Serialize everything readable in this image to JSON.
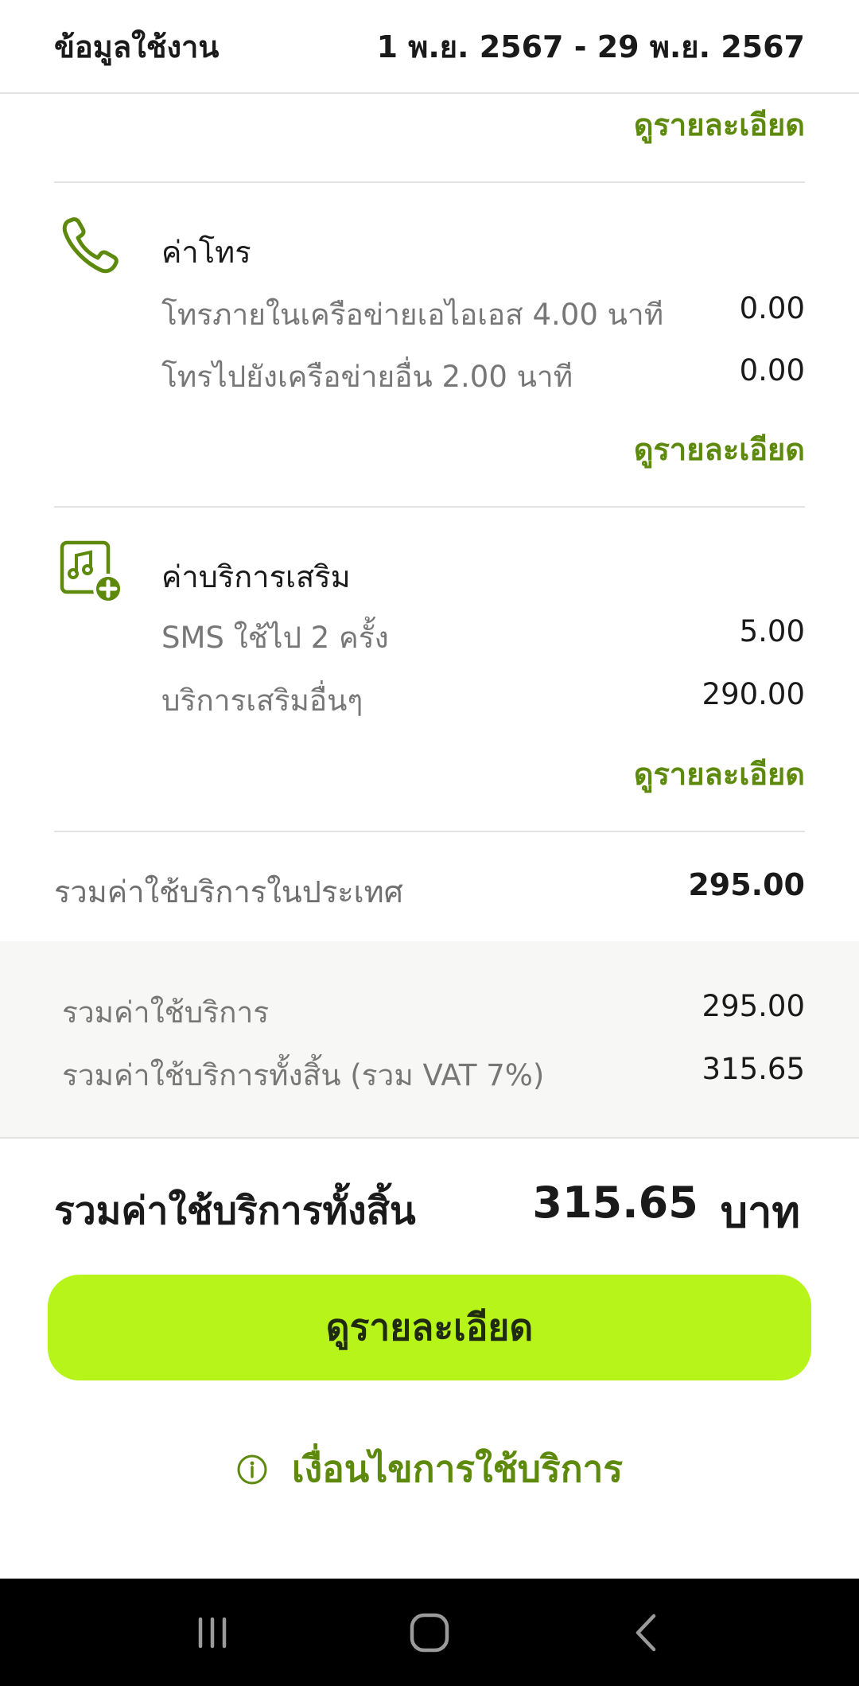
{
  "header": {
    "title": "ข้อมูลใช้งาน",
    "period": "1 พ.ย. 2567 - 29 พ.ย. 2567"
  },
  "top_link": "ดูรายละเอียด",
  "call_section": {
    "title": "ค่าโทร",
    "icon": "phone-icon",
    "rows": [
      {
        "label": "โทรภายในเครือข่ายเอไอเอส 4.00 นาที",
        "value": "0.00"
      },
      {
        "label": "โทรไปยังเครือข่ายอื่น 2.00 นาที",
        "value": "0.00"
      }
    ],
    "link": "ดูรายละเอียด"
  },
  "vas_section": {
    "title": "ค่าบริการเสริม",
    "icon": "music-add-icon",
    "rows": [
      {
        "label": "SMS ใช้ไป 2 ครั้ง",
        "value": "5.00"
      },
      {
        "label": "บริการเสริมอื่นๆ",
        "value": "290.00"
      }
    ],
    "link": "ดูรายละเอียด"
  },
  "domestic_total": {
    "label": "รวมค่าใช้บริการในประเทศ",
    "value": "295.00"
  },
  "summary": [
    {
      "label": "รวมค่าใช้บริการ",
      "value": "295.00"
    },
    {
      "label": "รวมค่าใช้บริการทั้งสิ้น (รวม VAT 7%)",
      "value": "315.65"
    }
  ],
  "grand_total": {
    "label": "รวมค่าใช้บริการทั้งสิ้น",
    "amount": "315.65",
    "currency": "บาท"
  },
  "cta_button": "ดูรายละเอียด",
  "terms_link": "เงื่อนไขการใช้บริการ",
  "nav": {
    "recents": "recents-icon",
    "home": "home-icon",
    "back": "back-icon"
  },
  "colors": {
    "accent": "#5d8a0c",
    "button": "#b6f41a",
    "summary_bg": "#f7f7f5"
  }
}
